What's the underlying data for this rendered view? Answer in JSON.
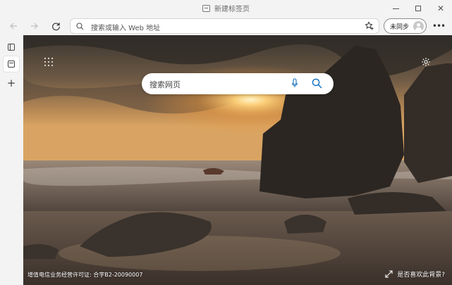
{
  "window": {
    "title": "新建标签页",
    "controls": {
      "minimize_icon": "minimize-icon",
      "maximize_icon": "maximize-icon",
      "close_icon": "close-icon"
    }
  },
  "toolbar": {
    "back_icon": "arrow-left-icon",
    "forward_icon": "arrow-right-icon",
    "refresh_icon": "refresh-icon",
    "address_placeholder": "搜索或输入 Web 地址",
    "favorite_icon": "add-favorite-icon",
    "sync_label": "未同步",
    "profile_icon": "avatar-icon",
    "more_icon": "more-icon"
  },
  "sidebar": {
    "items": [
      {
        "icon": "tab-actions-icon"
      },
      {
        "icon": "new-tab-icon",
        "selected": true
      },
      {
        "icon": "plus-icon"
      }
    ]
  },
  "newtab": {
    "apps_icon": "app-launcher-icon",
    "settings_icon": "gear-icon",
    "search_placeholder": "搜索网页",
    "mic_icon": "microphone-icon",
    "search_icon": "search-icon",
    "license_text": "增值电信业务经营许可证: 合字B2-20090007",
    "feedback_text": "是否喜欢此背景?",
    "feedback_icon": "expand-icon"
  },
  "colors": {
    "accent": "#0f6cbd",
    "chrome_bg": "#f3f3f3"
  }
}
